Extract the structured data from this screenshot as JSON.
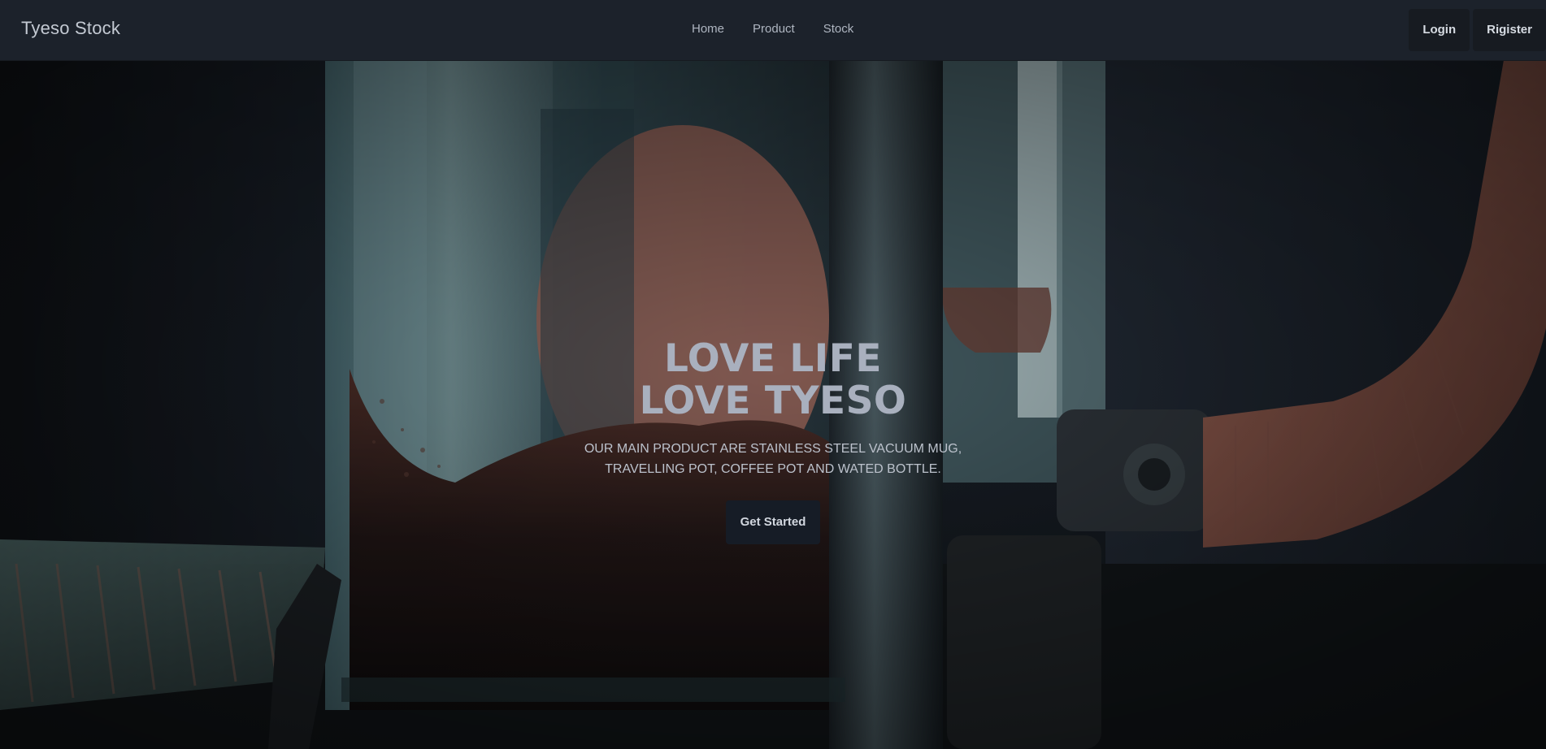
{
  "navbar": {
    "brand": "Tyeso Stock",
    "links": [
      "Home",
      "Product",
      "Stock"
    ],
    "login_label": "Login",
    "register_label": "Rigister"
  },
  "hero": {
    "headline_line1": "LOVE LIFE",
    "headline_line2": "LOVE TYESO",
    "subtitle_line1": "OUR MAIN PRODUCT ARE STAINLESS STEEL VACUUM MUG,",
    "subtitle_line2": "TRAVELLING POT, COFFEE POT AND WATED BOTTLE.",
    "cta_label": "Get Started",
    "background_image": "french-press-coffee-photo"
  },
  "colors": {
    "navbar_bg": "#1c222b",
    "headline": "#a9b0be",
    "cta_bg": "#161c26"
  }
}
